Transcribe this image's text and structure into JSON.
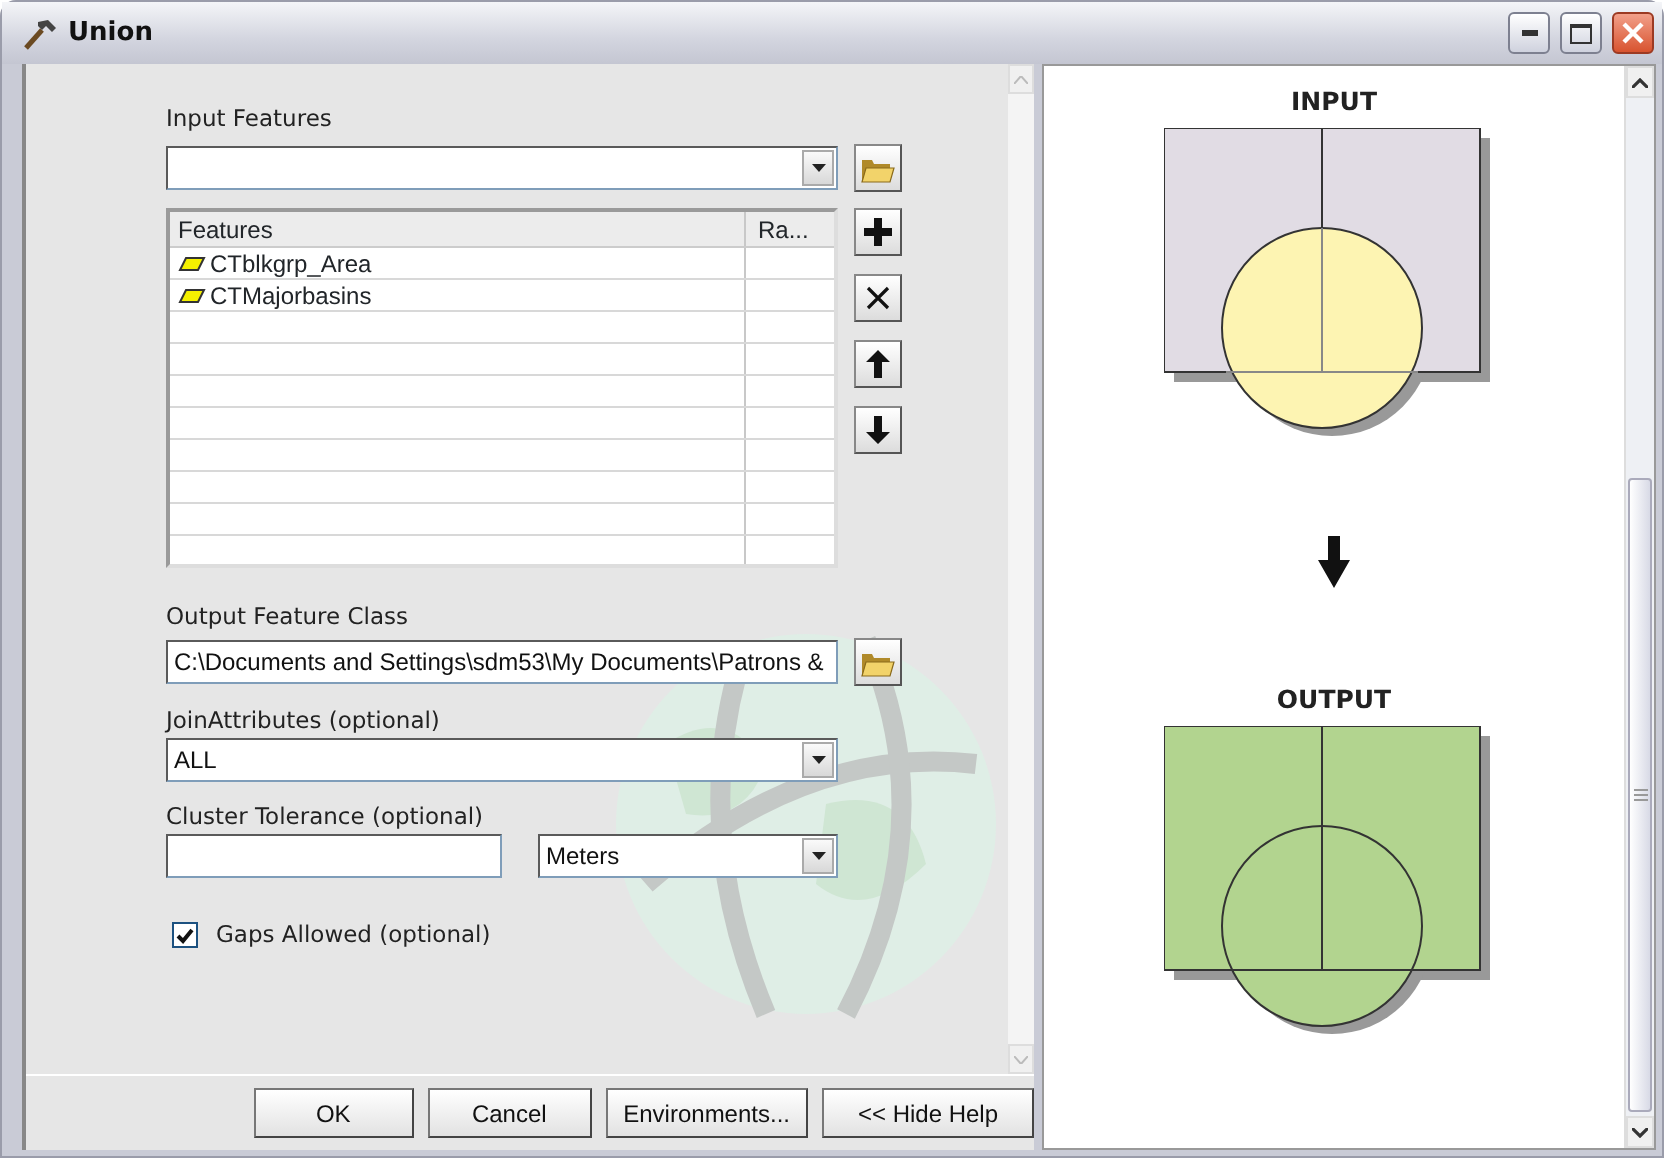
{
  "window": {
    "title": "Union"
  },
  "input_features": {
    "label": "Input Features"
  },
  "features_table": {
    "columns": [
      "Features",
      "Ra..."
    ],
    "rows": [
      {
        "name": "CTblkgrp_Area"
      },
      {
        "name": "CTMajorbasins"
      }
    ]
  },
  "output_feature_class": {
    "label": "Output Feature Class",
    "value": "C:\\Documents and Settings\\sdm53\\My Documents\\Patrons &"
  },
  "join_attributes": {
    "label": "JoinAttributes (optional)",
    "value": "ALL"
  },
  "cluster_tolerance": {
    "label": "Cluster Tolerance (optional)",
    "units": "Meters"
  },
  "gaps_allowed": {
    "label": "Gaps Allowed (optional)",
    "checked": true
  },
  "buttons": [
    "OK",
    "Cancel",
    "Environments...",
    "<< Hide Help"
  ],
  "help": {
    "input_heading": "INPUT",
    "output_heading": "OUTPUT"
  }
}
